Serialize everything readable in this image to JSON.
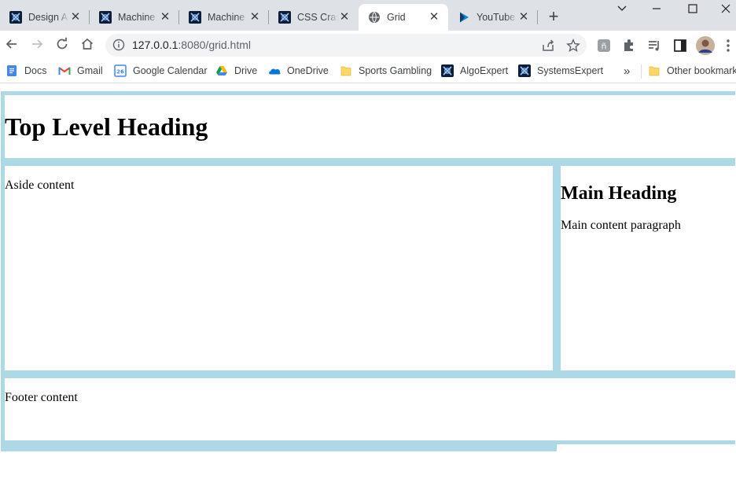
{
  "browser": {
    "tabs": [
      {
        "title": "Design A",
        "icon": "algoexpert-icon",
        "active": false
      },
      {
        "title": "Machine",
        "icon": "algoexpert-icon",
        "active": false
      },
      {
        "title": "Machine",
        "icon": "algoexpert-icon",
        "active": false
      },
      {
        "title": "CSS Crash",
        "icon": "algoexpert-icon",
        "active": false
      },
      {
        "title": "Grid",
        "icon": "globe-icon",
        "active": true
      },
      {
        "title": "YouTube",
        "icon": "play-icon",
        "active": false
      }
    ],
    "url_host": "127.0.0.1",
    "url_rest": ":8080/grid.html",
    "bookmarks": [
      {
        "label": "Docs",
        "icon": "docs-icon"
      },
      {
        "label": "Gmail",
        "icon": "gmail-icon"
      },
      {
        "label": "Google Calendar",
        "icon": "calendar-icon"
      },
      {
        "label": "Drive",
        "icon": "drive-icon"
      },
      {
        "label": "OneDrive",
        "icon": "onedrive-icon"
      },
      {
        "label": "Sports Gambling",
        "icon": "folder-icon"
      },
      {
        "label": "AlgoExpert",
        "icon": "algoexpert-icon"
      },
      {
        "label": "SystemsExpert",
        "icon": "algoexpert-icon"
      }
    ],
    "more_bookmarks": "»",
    "other_bookmarks": "Other bookmarks",
    "calendar_day": "26"
  },
  "page": {
    "heading": "Top Level Heading",
    "aside_text": "Aside content",
    "main_heading": "Main Heading",
    "main_paragraph": "Main content paragraph",
    "footer_text": "Footer content"
  },
  "colors": {
    "grid_background": "#add8e6",
    "cell_background": "#ffffff",
    "tabstrip": "#dee1e6"
  }
}
